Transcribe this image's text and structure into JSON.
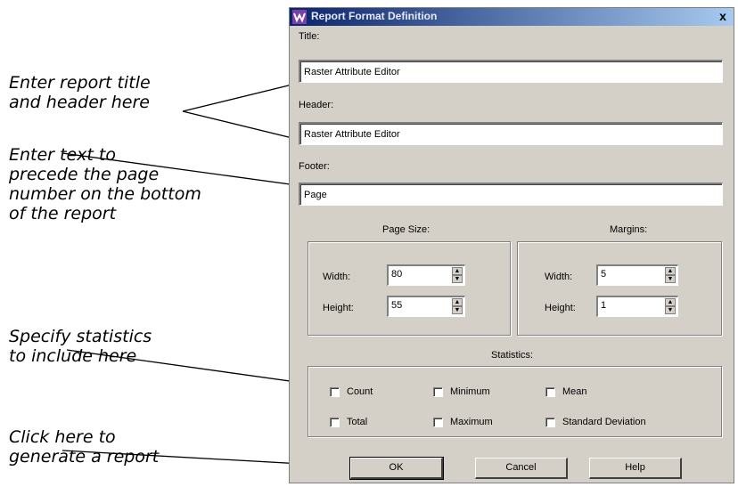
{
  "callouts": {
    "title_header": [
      "Enter report title",
      "and header here"
    ],
    "footer": [
      "Enter text to",
      "precede the page",
      "number on the bottom",
      "of the report"
    ],
    "statistics": [
      "Specify statistics",
      "to include here"
    ],
    "ok": [
      "Click here to",
      "generate a report"
    ]
  },
  "dialog": {
    "title": "Report Format Definition",
    "close_glyph": "x",
    "title_label": "Title:",
    "title_value": "Raster Attribute Editor",
    "header_label": "Header:",
    "header_value": "Raster Attribute Editor",
    "footer_label": "Footer:",
    "footer_value": "Page",
    "page_size": {
      "label": "Page Size:",
      "width_label": "Width:",
      "width_value": "80",
      "height_label": "Height:",
      "height_value": "55"
    },
    "margins": {
      "label": "Margins:",
      "width_label": "Width:",
      "width_value": "5",
      "height_label": "Height:",
      "height_value": "1"
    },
    "statistics": {
      "label": "Statistics:",
      "items": [
        {
          "label": "Count",
          "checked": false
        },
        {
          "label": "Minimum",
          "checked": false
        },
        {
          "label": "Mean",
          "checked": false
        },
        {
          "label": "Total",
          "checked": false
        },
        {
          "label": "Maximum",
          "checked": false
        },
        {
          "label": "Standard Deviation",
          "checked": false
        }
      ]
    },
    "buttons": {
      "ok": "OK",
      "cancel": "Cancel",
      "help": "Help"
    }
  }
}
